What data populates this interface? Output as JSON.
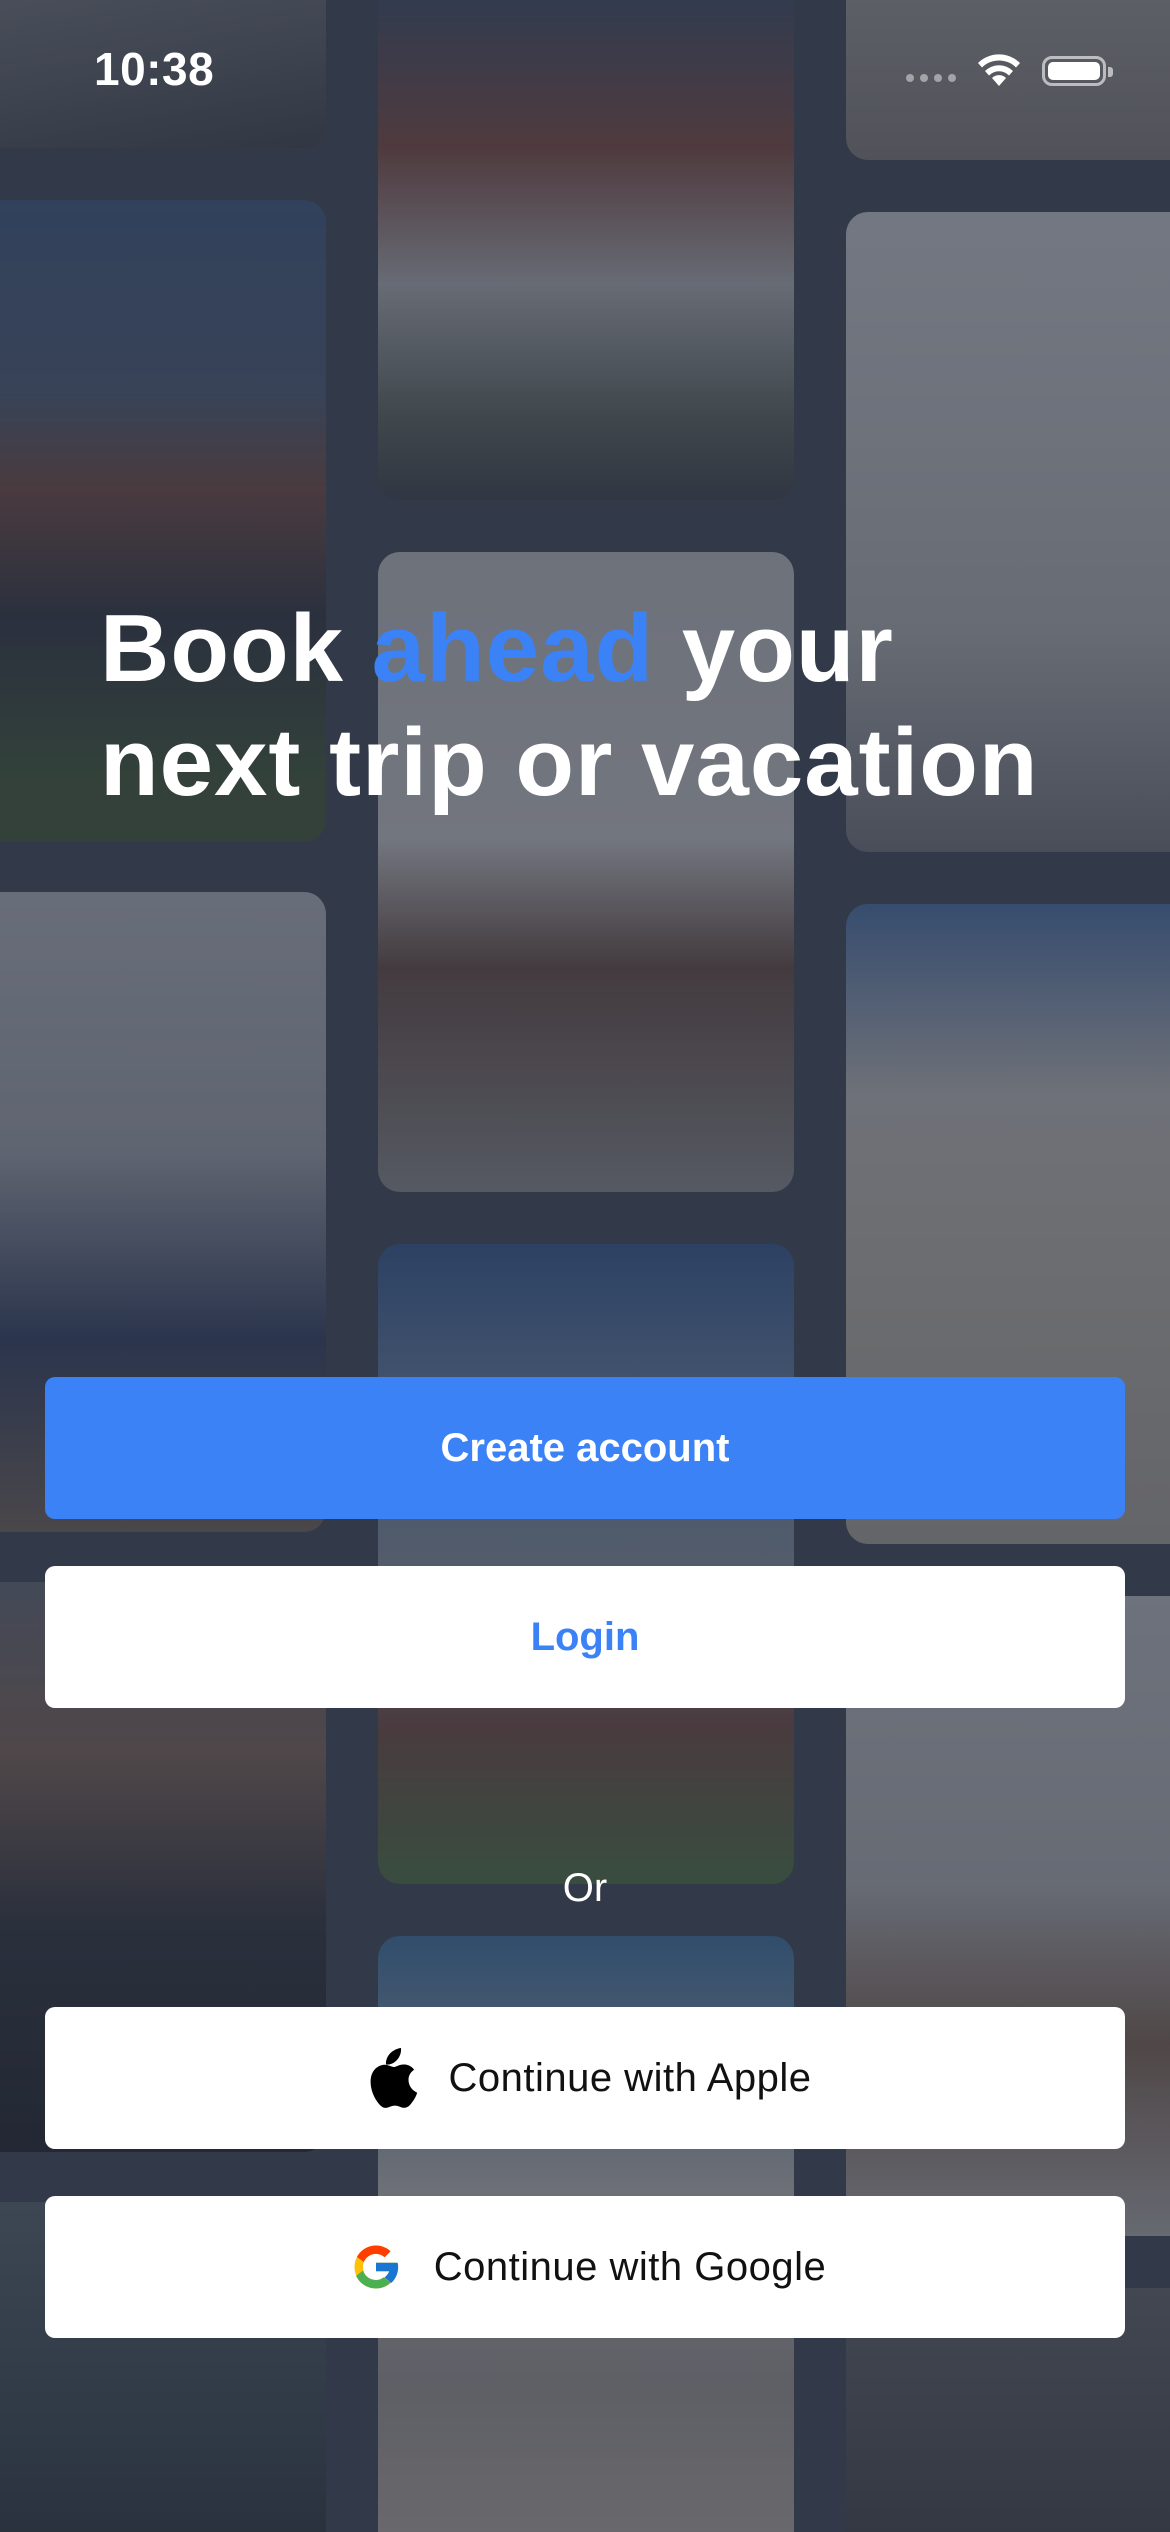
{
  "status_bar": {
    "time": "10:38",
    "icons": [
      "cellular-signal-icon",
      "wifi-icon",
      "battery-icon"
    ]
  },
  "headline": {
    "line1_part1": "Book ",
    "line1_accent": "ahead",
    "line1_part2": " your",
    "line2": "next trip or vacation",
    "accent_color": "#3b82f6"
  },
  "actions": {
    "create_account_label": "Create account",
    "login_label": "Login",
    "divider_label": "Or",
    "apple_label": "Continue with Apple",
    "google_label": "Continue with Google",
    "primary_color": "#3b82f6"
  }
}
